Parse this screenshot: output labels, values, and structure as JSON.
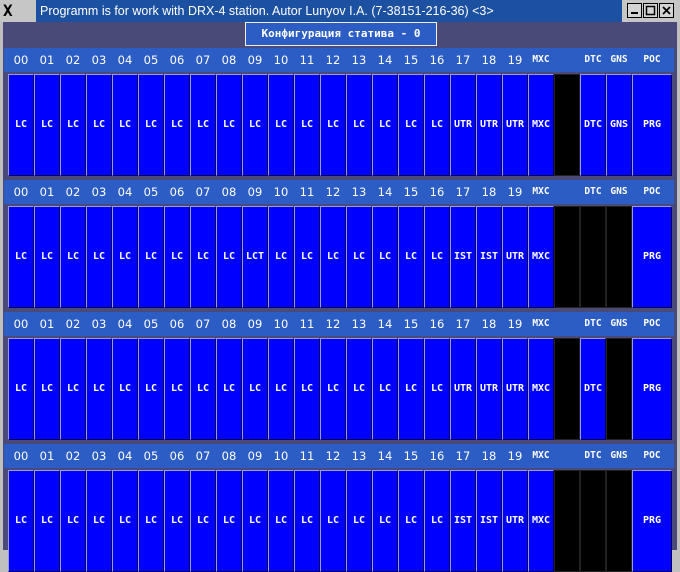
{
  "window": {
    "title": "Programm is for work with DRX-4 station. Autor Lunyov I.A. (7-38151-216-36) <3>",
    "logo_icon": "x-window-icon",
    "buttons": [
      "minimize",
      "maximize",
      "close"
    ]
  },
  "config_label": "Конфигурация статива - 0",
  "headers": [
    "00",
    "01",
    "02",
    "03",
    "04",
    "05",
    "06",
    "07",
    "08",
    "09",
    "10",
    "11",
    "12",
    "13",
    "14",
    "15",
    "16",
    "17",
    "18",
    "19",
    "MXC",
    "",
    "DTC",
    "GNS",
    "POC"
  ],
  "shelves": [
    {
      "slots": [
        "LC",
        "LC",
        "LC",
        "LC",
        "LC",
        "LC",
        "LC",
        "LC",
        "LC",
        "LC",
        "LC",
        "LC",
        "LC",
        "LC",
        "LC",
        "LC",
        "LC",
        "UTR",
        "UTR",
        "UTR",
        "MXC",
        "",
        "DTC",
        "GNS",
        "PRG"
      ]
    },
    {
      "slots": [
        "LC",
        "LC",
        "LC",
        "LC",
        "LC",
        "LC",
        "LC",
        "LC",
        "LC",
        "LCT",
        "LC",
        "LC",
        "LC",
        "LC",
        "LC",
        "LC",
        "LC",
        "IST",
        "IST",
        "UTR",
        "MXC",
        "",
        "",
        "",
        "PRG"
      ]
    },
    {
      "slots": [
        "LC",
        "LC",
        "LC",
        "LC",
        "LC",
        "LC",
        "LC",
        "LC",
        "LC",
        "LC",
        "LC",
        "LC",
        "LC",
        "LC",
        "LC",
        "LC",
        "LC",
        "UTR",
        "UTR",
        "UTR",
        "MXC",
        "",
        "DTC",
        "",
        "PRG"
      ]
    },
    {
      "slots": [
        "LC",
        "LC",
        "LC",
        "LC",
        "LC",
        "LC",
        "LC",
        "LC",
        "LC",
        "LC",
        "LC",
        "LC",
        "LC",
        "LC",
        "LC",
        "LC",
        "LC",
        "IST",
        "IST",
        "UTR",
        "MXC",
        "",
        "",
        "",
        "PRG"
      ]
    }
  ],
  "colors": {
    "slot": "#0000ff",
    "empty_slot": "#000000",
    "header": "#2b5dc4",
    "background": "#4a4a78",
    "titlebar": "#1c50a0"
  }
}
